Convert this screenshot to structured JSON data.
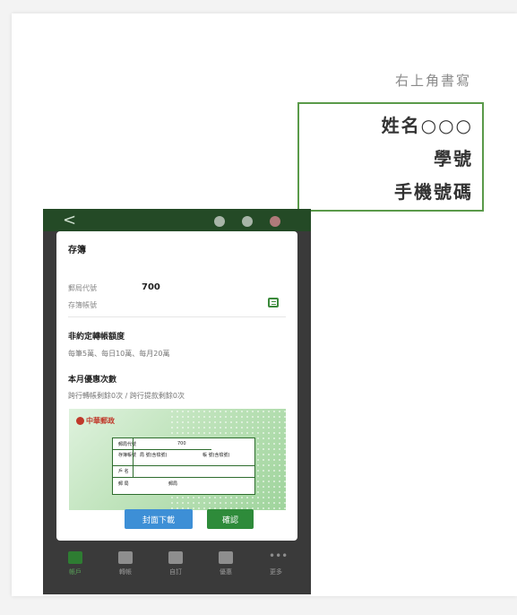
{
  "note": {
    "title": "右上角書寫",
    "lines": [
      "姓名○○○",
      "學號",
      "手機號碼"
    ]
  },
  "phone": {
    "dialog": {
      "section_title": "存簿",
      "post_code_label": "郵局代號",
      "post_code_value": "700",
      "account_label": "存簿帳號",
      "limit_title": "非約定轉帳額度",
      "limit_text": "每筆5萬、每日10萬、每月20萬",
      "discount_title": "本月優惠次數",
      "discount_text": "跨行轉帳剩餘0次 / 跨行提款剩餘0次",
      "card": {
        "brand": "中華郵政",
        "code_label": "郵局代號",
        "code_value": "700",
        "book_label": "存簿帳號",
        "book_a": "局 號(含檢號)",
        "book_b": "帳 號(含檢號)",
        "name_label": "戶 名",
        "office_label": "郵 局",
        "office_value": "郵局"
      },
      "download_button": "封面下載",
      "confirm_button": "確認"
    },
    "tabs": [
      {
        "label": "帳戶",
        "icon": "wallet-icon"
      },
      {
        "label": "轉帳",
        "icon": "transfer-icon"
      },
      {
        "label": "自訂",
        "icon": "custom-icon"
      },
      {
        "label": "優惠",
        "icon": "gift-icon"
      },
      {
        "label": "更多",
        "icon": "more-icon"
      }
    ],
    "colors": {
      "header": "#244a26",
      "confirm": "#2e8b3a",
      "download": "#3d8fd6",
      "accent": "#5a9a4a"
    }
  }
}
